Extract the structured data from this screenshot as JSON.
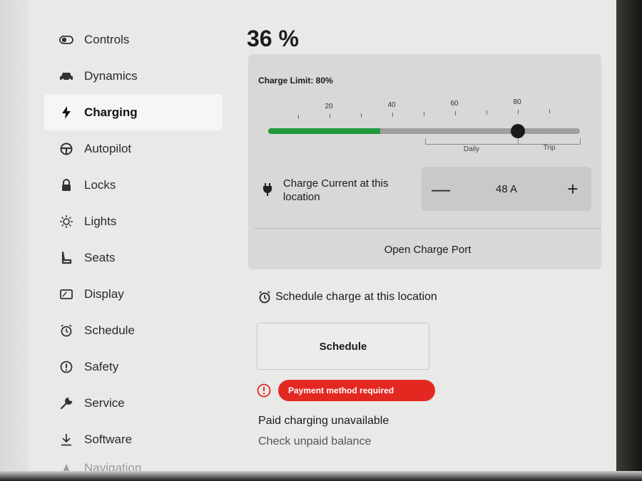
{
  "sidebar": {
    "items": [
      {
        "label": "Controls",
        "icon": "toggle-icon"
      },
      {
        "label": "Dynamics",
        "icon": "car-icon"
      },
      {
        "label": "Charging",
        "icon": "bolt-icon",
        "active": true
      },
      {
        "label": "Autopilot",
        "icon": "steering-wheel-icon"
      },
      {
        "label": "Locks",
        "icon": "lock-icon"
      },
      {
        "label": "Lights",
        "icon": "light-icon"
      },
      {
        "label": "Seats",
        "icon": "seat-icon"
      },
      {
        "label": "Display",
        "icon": "display-icon"
      },
      {
        "label": "Schedule",
        "icon": "alarm-clock-icon"
      },
      {
        "label": "Safety",
        "icon": "info-circle-icon"
      },
      {
        "label": "Service",
        "icon": "wrench-icon"
      },
      {
        "label": "Software",
        "icon": "download-icon"
      },
      {
        "label": "Navigation",
        "icon": "navigation-icon"
      }
    ]
  },
  "charging": {
    "battery_level": "36 %",
    "charge_limit_label": "Charge Limit: 80%",
    "charge_limit_value": 80,
    "current_level_value": 36,
    "ticks": [
      "20",
      "40",
      "60",
      "80"
    ],
    "range_labels": {
      "daily": "Daily",
      "trip": "Trip"
    },
    "charge_current_label": "Charge Current at this location",
    "current_value": "48 A",
    "decrement_symbol": "—",
    "increment_symbol": "+",
    "open_port_label": "Open Charge Port",
    "schedule_heading": "Schedule charge at this location",
    "schedule_button": "Schedule",
    "payment_badge": "Payment method required",
    "paid_unavailable": "Paid charging unavailable",
    "unpaid_balance": "Check unpaid balance"
  },
  "colors": {
    "accent_green": "#1e9a3a",
    "alert_red": "#e32822"
  }
}
